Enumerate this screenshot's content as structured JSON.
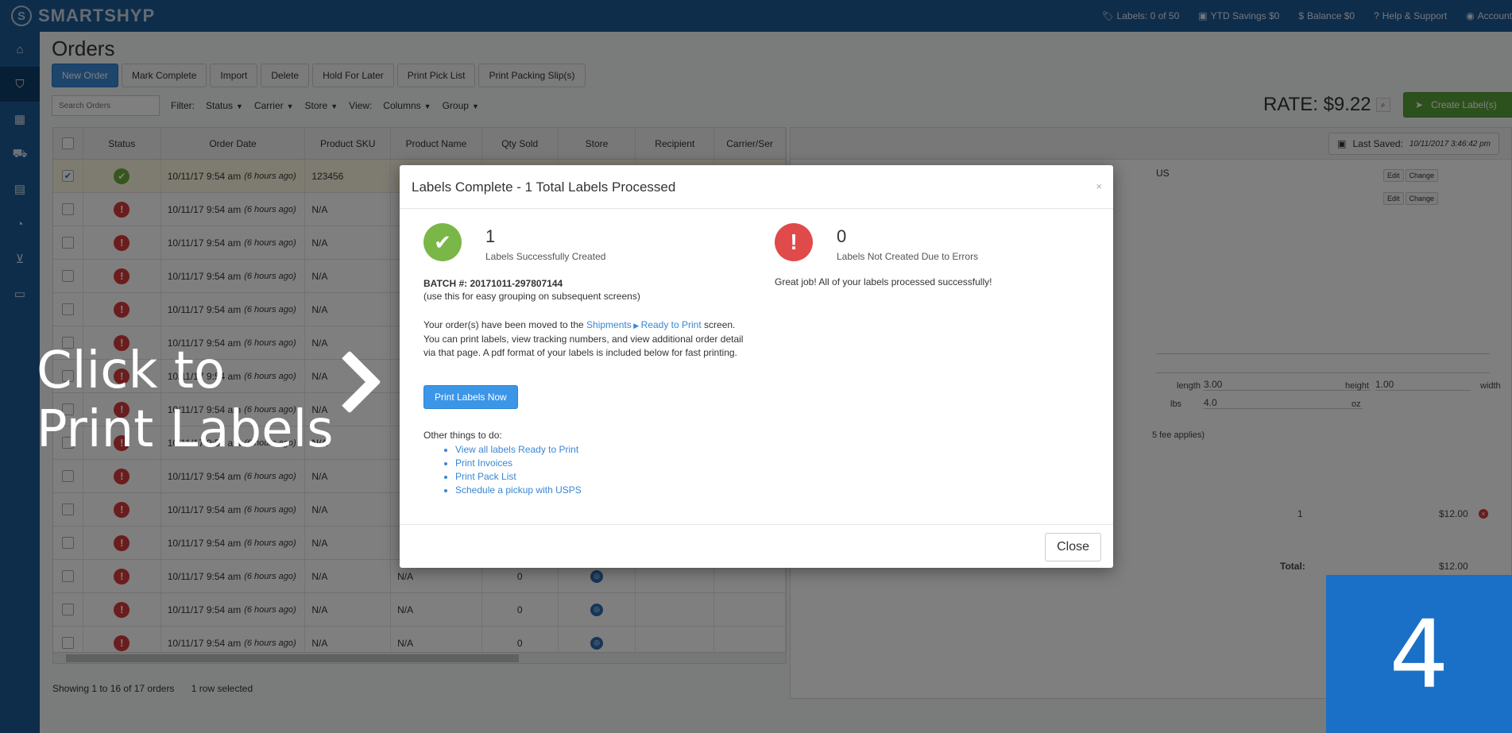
{
  "app": {
    "name": "SMARTSHYP",
    "logo_mark": "S"
  },
  "topbar": {
    "labels": "Labels: 0 of 50",
    "ytd_savings": "YTD Savings $0",
    "balance": "Balance $0",
    "help": "Help & Support",
    "account": "Account"
  },
  "nav": [
    "home-icon",
    "basket-icon",
    "calendar-icon",
    "truck-icon",
    "contacts-icon",
    "pie-chart-icon",
    "cart-icon",
    "lock-icon"
  ],
  "page": {
    "title": "Orders"
  },
  "toolbar": {
    "new_order": "New Order",
    "mark_complete": "Mark Complete",
    "import": "Import",
    "delete": "Delete",
    "hold": "Hold For Later",
    "pick_list": "Print Pick List",
    "packing": "Print Packing Slip(s)"
  },
  "filters": {
    "search_placeholder": "Search Orders",
    "filter": "Filter:",
    "status": "Status",
    "carrier": "Carrier",
    "store": "Store",
    "view": "View:",
    "columns": "Columns",
    "group": "Group"
  },
  "rate": "RATE: $9.22",
  "create_labels": "Create Label(s)",
  "table": {
    "headers": [
      "Status",
      "Order Date",
      "Product SKU",
      "Product Name",
      "Qty Sold",
      "Store",
      "Recipient",
      "Carrier/Ser"
    ],
    "rows": [
      {
        "status": "ok",
        "date": "10/11/17 9:54 am",
        "ago": "(6 hours ago)",
        "sku": "123456",
        "name": "",
        "qty": "",
        "store": false,
        "checked": true
      },
      {
        "status": "err",
        "date": "10/11/17 9:54 am",
        "ago": "(6 hours ago)",
        "sku": "N/A",
        "name": "",
        "qty": "",
        "store": false,
        "checked": false
      },
      {
        "status": "err",
        "date": "10/11/17 9:54 am",
        "ago": "(6 hours ago)",
        "sku": "N/A",
        "name": "",
        "qty": "",
        "store": false,
        "checked": false
      },
      {
        "status": "err",
        "date": "10/11/17 9:54 am",
        "ago": "(6 hours ago)",
        "sku": "N/A",
        "name": "",
        "qty": "",
        "store": false,
        "checked": false
      },
      {
        "status": "err",
        "date": "10/11/17 9:54 am",
        "ago": "(6 hours ago)",
        "sku": "N/A",
        "name": "",
        "qty": "",
        "store": false,
        "checked": false
      },
      {
        "status": "err",
        "date": "10/11/17 9:54 am",
        "ago": "(6 hours ago)",
        "sku": "N/A",
        "name": "",
        "qty": "",
        "store": false,
        "checked": false
      },
      {
        "status": "err",
        "date": "10/11/17 9:54 am",
        "ago": "(6 hours ago)",
        "sku": "N/A",
        "name": "",
        "qty": "",
        "store": false,
        "checked": false
      },
      {
        "status": "err",
        "date": "10/11/17 9:54 am",
        "ago": "(6 hours ago)",
        "sku": "N/A",
        "name": "",
        "qty": "",
        "store": false,
        "checked": false
      },
      {
        "status": "err",
        "date": "10/11/17 9:54 am",
        "ago": "(6 hours ago)",
        "sku": "N/A",
        "name": "",
        "qty": "",
        "store": false,
        "checked": false
      },
      {
        "status": "err",
        "date": "10/11/17 9:54 am",
        "ago": "(6 hours ago)",
        "sku": "N/A",
        "name": "",
        "qty": "",
        "store": false,
        "checked": false
      },
      {
        "status": "err",
        "date": "10/11/17 9:54 am",
        "ago": "(6 hours ago)",
        "sku": "N/A",
        "name": "",
        "qty": "",
        "store": false,
        "checked": false
      },
      {
        "status": "err",
        "date": "10/11/17 9:54 am",
        "ago": "(6 hours ago)",
        "sku": "N/A",
        "name": "",
        "qty": "",
        "store": false,
        "checked": false
      },
      {
        "status": "err",
        "date": "10/11/17 9:54 am",
        "ago": "(6 hours ago)",
        "sku": "N/A",
        "name": "N/A",
        "qty": "0",
        "store": true,
        "checked": false
      },
      {
        "status": "err",
        "date": "10/11/17 9:54 am",
        "ago": "(6 hours ago)",
        "sku": "N/A",
        "name": "N/A",
        "qty": "0",
        "store": true,
        "checked": false
      },
      {
        "status": "err",
        "date": "10/11/17 9:54 am",
        "ago": "(6 hours ago)",
        "sku": "N/A",
        "name": "N/A",
        "qty": "0",
        "store": true,
        "checked": false
      }
    ]
  },
  "footer_status": {
    "showing": "Showing 1 to 16 of 17 orders",
    "selected": "1 row selected"
  },
  "pane": {
    "last_saved_label": "Last Saved:",
    "last_saved_value": "10/11/2017 3:46:42 pm",
    "country": "US",
    "edit": "Edit",
    "change": "Change",
    "length_label": "length",
    "length_value": "3.00",
    "height_label": "height",
    "height_value": "1.00",
    "width_label": "width",
    "lbs_label": "lbs",
    "lbs_value": "4.0",
    "oz_label": "oz",
    "fee_note": "5 fee applies)",
    "qty": "1",
    "price": "$12.00",
    "total_label": "Total:",
    "total_value": "$12.00"
  },
  "modal": {
    "title": "Labels Complete - 1 Total Labels Processed",
    "success_count": "1",
    "success_label": "Labels Successfully Created",
    "error_count": "0",
    "error_label": "Labels Not Created Due to Errors",
    "batch": "BATCH #: 20171011-297807144",
    "batch_note": "(use this for easy grouping on subsequent screens)",
    "moved_pre": "Your order(s) have been moved to the ",
    "link_shipments": "Shipments",
    "link_ready": "Ready to Print",
    "moved_post": " screen. You can print labels, view tracking numbers, and view additional order detail via that page. A pdf format of your labels is included below for fast printing.",
    "print_button": "Print Labels Now",
    "other_title": "Other things to do:",
    "other_items": [
      "View all labels Ready to Print",
      "Print Invoices",
      "Print Pack List",
      "Schedule a pickup with USPS"
    ],
    "great": "Great job! All of your labels processed successfully!",
    "close": "Close"
  },
  "annotation": {
    "line1": "Click to",
    "line2": "Print Labels",
    "step": "4"
  }
}
